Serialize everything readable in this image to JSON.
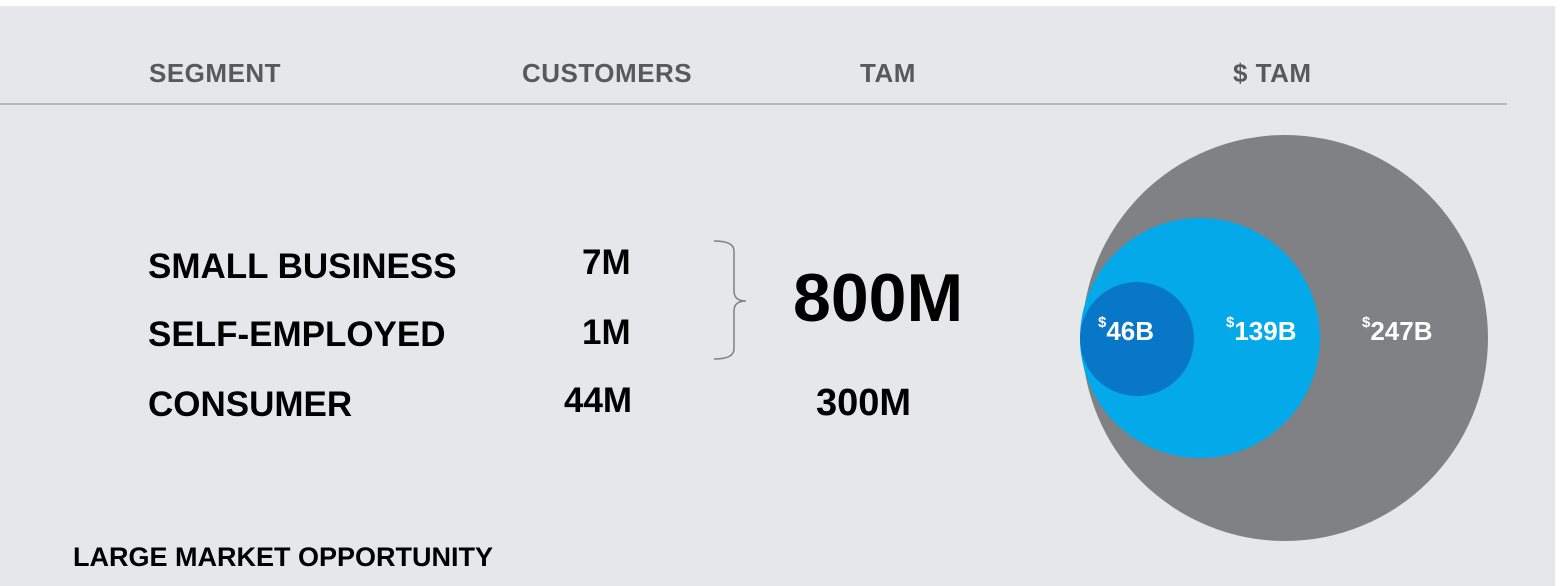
{
  "header": {
    "segment": "SEGMENT",
    "customers": "CUSTOMERS",
    "tam": "TAM",
    "dollar_tam": "$ TAM"
  },
  "rows": [
    {
      "segment": "SMALL BUSINESS",
      "customers": "7M"
    },
    {
      "segment": "SELF-EMPLOYED",
      "customers": "1M"
    },
    {
      "segment": "CONSUMER",
      "customers": "44M"
    }
  ],
  "tam": {
    "business_combined": "800M",
    "consumer": "300M"
  },
  "circles": [
    {
      "currency": "$",
      "value": "46B",
      "color": "#0877c7"
    },
    {
      "currency": "$",
      "value": "139B",
      "color": "#03a9e9"
    },
    {
      "currency": "$",
      "value": "247B",
      "color": "#808184"
    }
  ],
  "footer": "LARGE MARKET OPPORTUNITY"
}
